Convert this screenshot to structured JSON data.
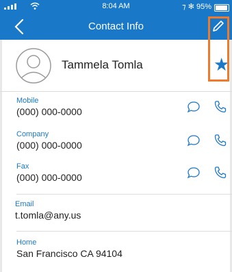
{
  "status_bar": {
    "time": "8:04 AM",
    "right_text": "⁊ ✻ 95%"
  },
  "nav": {
    "title": "Contact Info",
    "back_icon": "chevron-left-icon",
    "edit_icon": "pencil-icon"
  },
  "contact": {
    "name": "Tammela Tomla",
    "favorite_icon": "star-icon"
  },
  "fields": [
    {
      "label": "Mobile",
      "value": "(000) 000-0000"
    },
    {
      "label": "Company",
      "value": "(000) 000-0000"
    },
    {
      "label": "Fax",
      "value": "(000) 000-0000"
    },
    {
      "label": "Email",
      "value": "t.tomla@any.us"
    },
    {
      "label": "Home",
      "value": "San Francisco CA 94104"
    }
  ],
  "colors": {
    "accent": "#1a78c9",
    "highlight": "#f07a2a"
  }
}
